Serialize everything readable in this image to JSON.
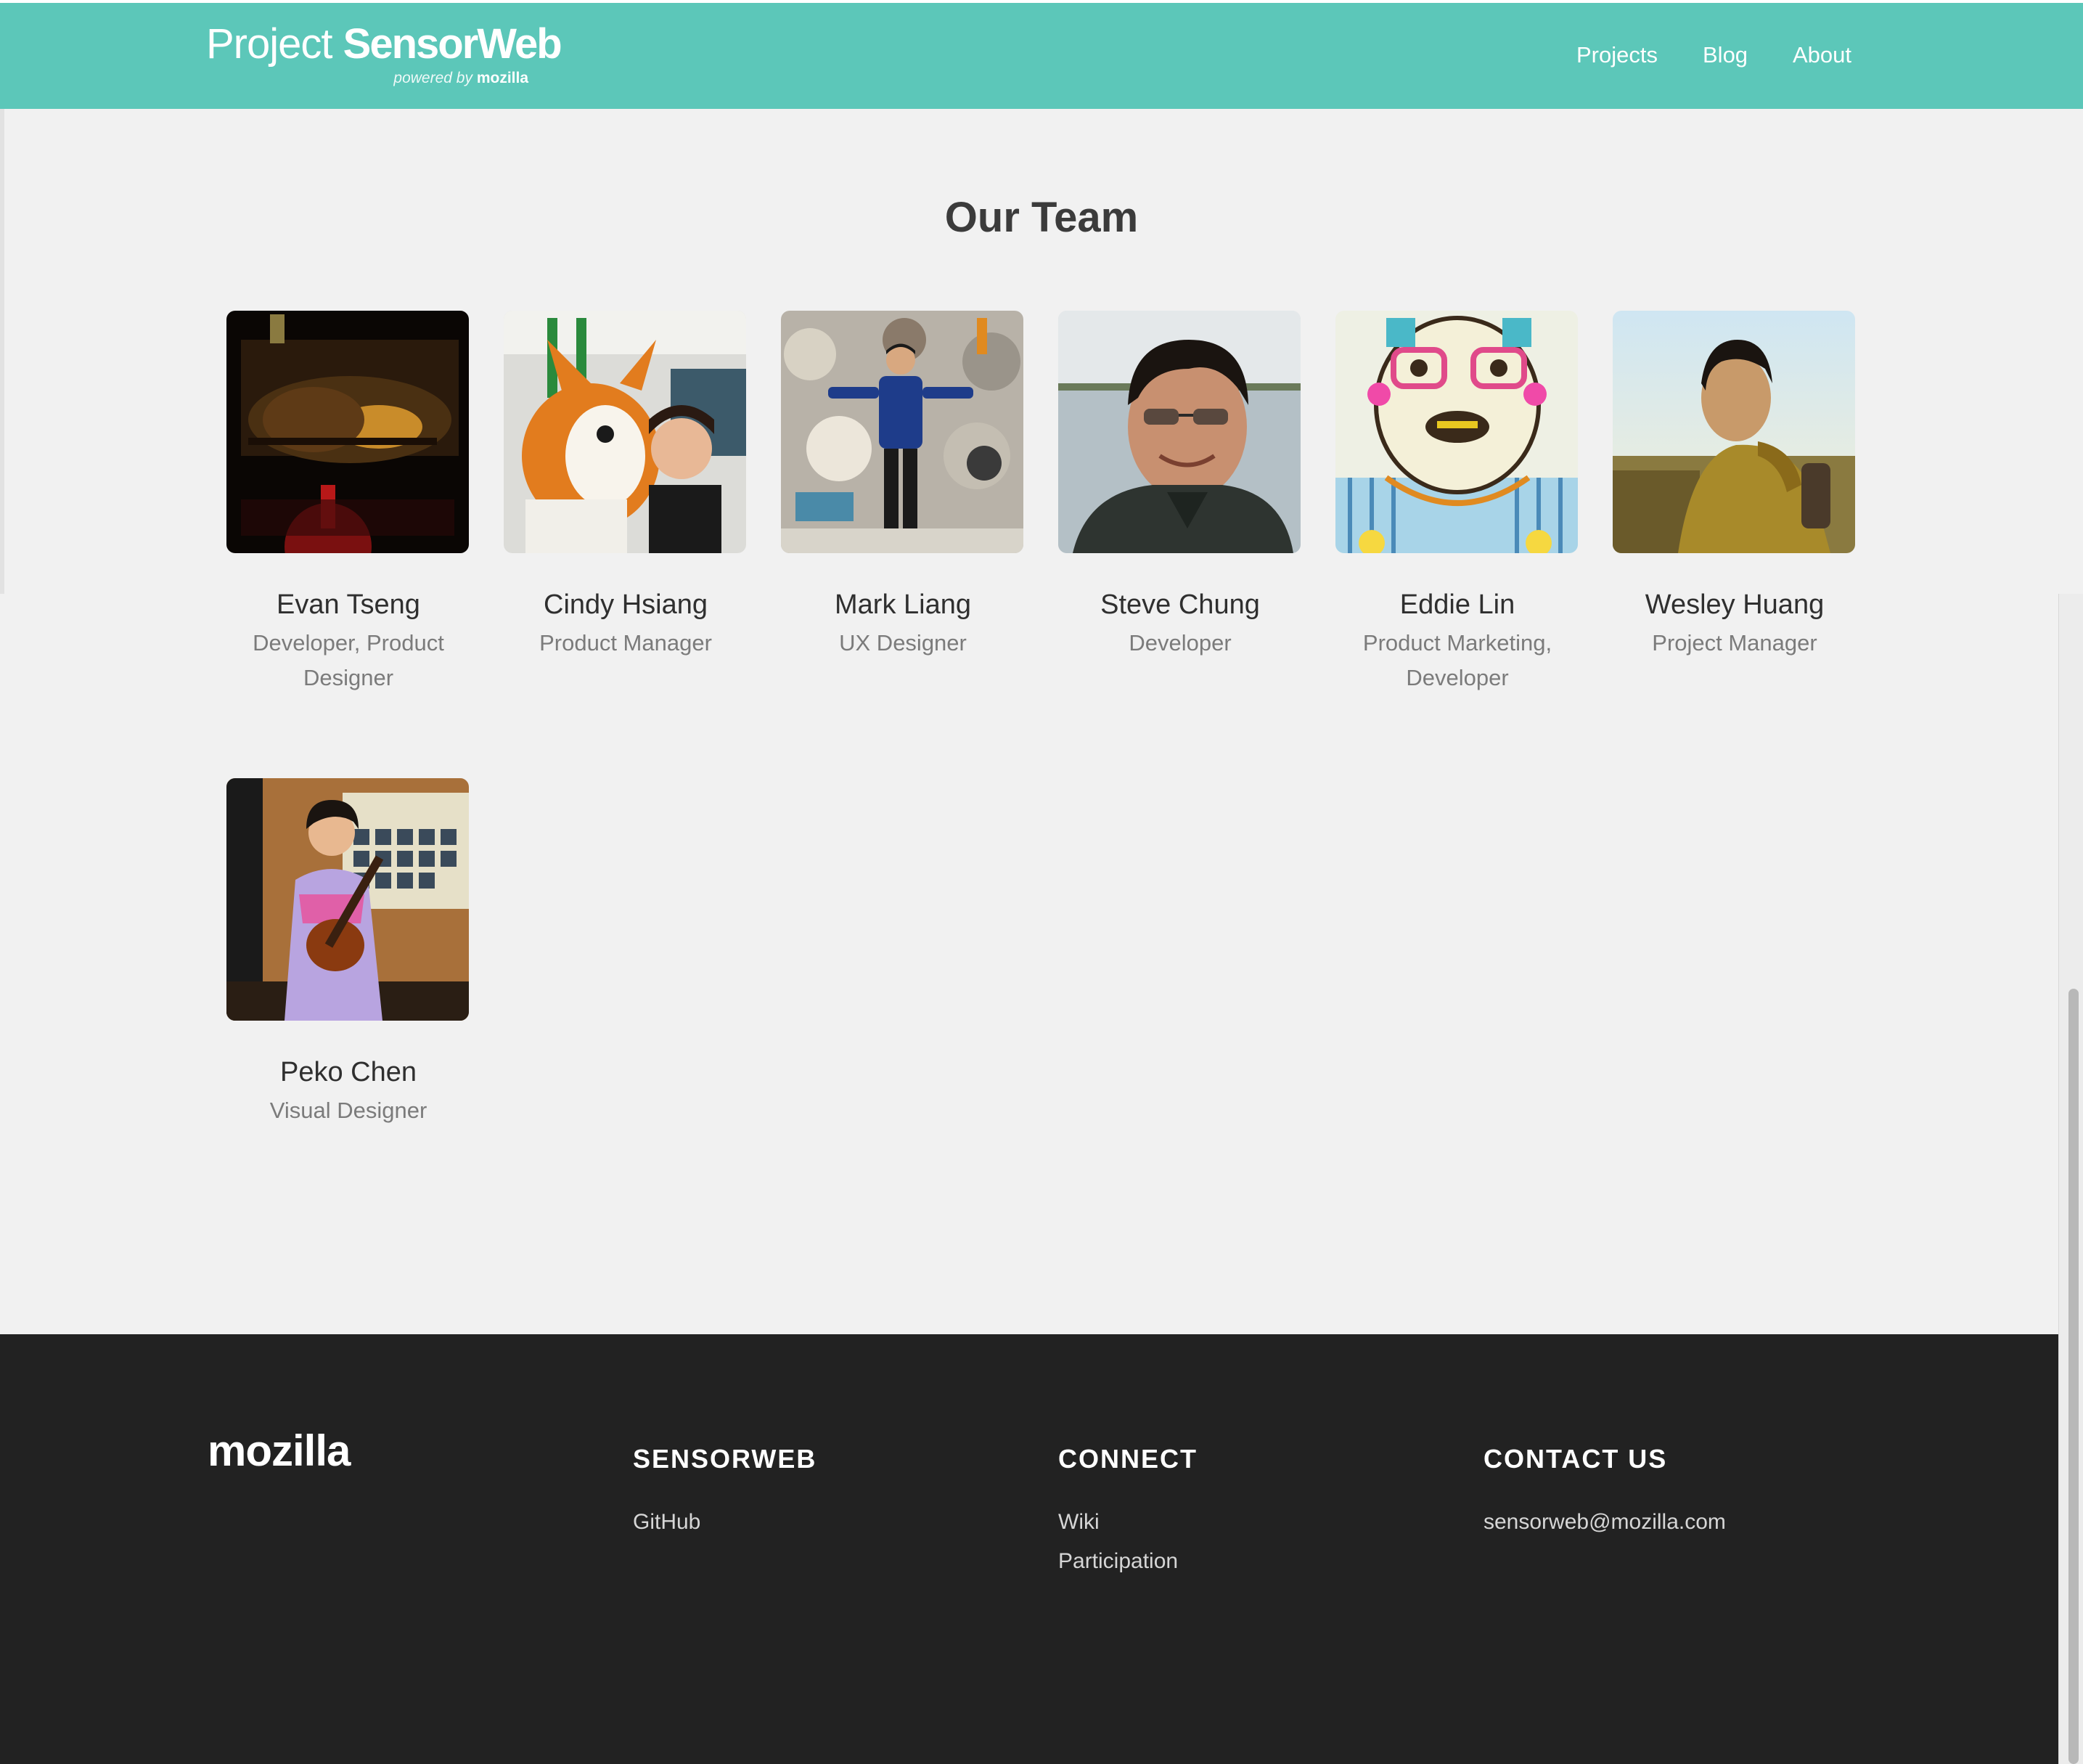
{
  "header": {
    "brand_prefix": "Project ",
    "brand_name": "SensorWeb",
    "brand_powered": "powered by ",
    "brand_powered_by": "mozilla",
    "nav": [
      "Projects",
      "Blog",
      "About"
    ]
  },
  "main": {
    "title": "Our Team",
    "team": [
      {
        "name": "Evan Tseng",
        "role": "Developer, Product Designer"
      },
      {
        "name": "Cindy Hsiang",
        "role": "Product Manager"
      },
      {
        "name": "Mark Liang",
        "role": "UX Designer"
      },
      {
        "name": "Steve Chung",
        "role": "Developer"
      },
      {
        "name": "Eddie Lin",
        "role": "Product Marketing, Developer"
      },
      {
        "name": "Wesley Huang",
        "role": "Project Manager"
      },
      {
        "name": "Peko Chen",
        "role": "Visual Designer"
      }
    ]
  },
  "footer": {
    "logo": "mozilla",
    "columns": [
      {
        "heading": "SENSORWEB",
        "links": [
          "GitHub"
        ]
      },
      {
        "heading": "CONNECT",
        "links": [
          "Wiki",
          "Participation"
        ]
      },
      {
        "heading": "CONTACT US",
        "links": [
          "sensorweb@mozilla.com"
        ]
      }
    ]
  },
  "colors": {
    "header_bg": "#5cc7b9",
    "page_bg": "#f1f1f1",
    "footer_bg": "#222222",
    "heading_text": "#3b3b3b",
    "role_text": "#7b7b7b"
  }
}
